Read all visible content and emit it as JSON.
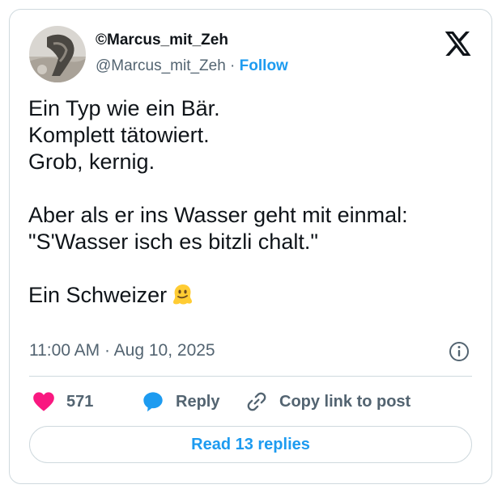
{
  "author": {
    "display_name": "©Marcus_mit_Zeh",
    "handle": "@Marcus_mit_Zeh",
    "separator": " · ",
    "follow_label": "Follow"
  },
  "tweet": {
    "lines_block1": [
      "Ein Typ wie ein Bär.",
      "Komplett tätowiert.",
      "Grob, kernig."
    ],
    "lines_block2": [
      "Aber als er ins Wasser geht mit einmal:",
      "\"S'Wasser isch es bitzli chalt.\""
    ],
    "line_block3": "Ein Schweizer",
    "emoji": "melting-face",
    "timestamp": "11:00 AM · Aug 10, 2025"
  },
  "actions": {
    "like_count": "571",
    "reply_label": "Reply",
    "copy_link_label": "Copy link to post"
  },
  "read_replies_label": "Read 13 replies",
  "colors": {
    "accent": "#1d9bf0",
    "heart": "#f91880",
    "text": "#0f1419",
    "muted": "#536471",
    "border": "#cfd9de"
  },
  "icons": [
    "x-logo-icon",
    "info-icon",
    "heart-icon",
    "reply-bubble-icon",
    "link-icon",
    "melting-face-emoji"
  ]
}
